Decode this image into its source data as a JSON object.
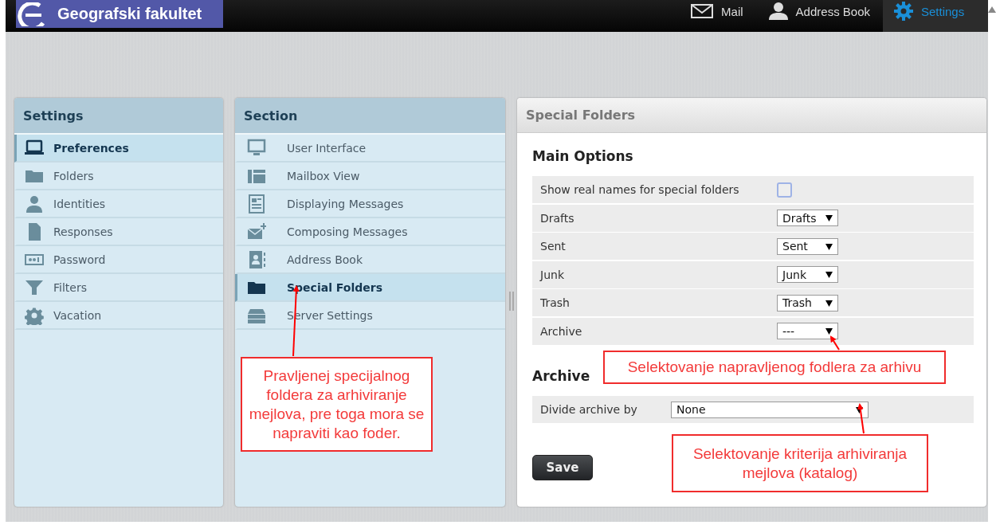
{
  "header": {
    "brand": "Geografski fakultet",
    "nav": [
      {
        "label": "Mail",
        "selected": false
      },
      {
        "label": "Address Book",
        "selected": false
      },
      {
        "label": "Settings",
        "selected": true
      }
    ]
  },
  "settings_panel": {
    "title": "Settings",
    "items": [
      {
        "label": "Preferences",
        "selected": true
      },
      {
        "label": "Folders",
        "selected": false
      },
      {
        "label": "Identities",
        "selected": false
      },
      {
        "label": "Responses",
        "selected": false
      },
      {
        "label": "Password",
        "selected": false
      },
      {
        "label": "Filters",
        "selected": false
      },
      {
        "label": "Vacation",
        "selected": false
      }
    ]
  },
  "section_panel": {
    "title": "Section",
    "items": [
      {
        "label": "User Interface",
        "selected": false
      },
      {
        "label": "Mailbox View",
        "selected": false
      },
      {
        "label": "Displaying Messages",
        "selected": false
      },
      {
        "label": "Composing Messages",
        "selected": false
      },
      {
        "label": "Address Book",
        "selected": false
      },
      {
        "label": "Special Folders",
        "selected": true
      },
      {
        "label": "Server Settings",
        "selected": false
      }
    ]
  },
  "content": {
    "title": "Special Folders",
    "main_options": {
      "heading": "Main Options",
      "rows": [
        {
          "kind": "checkbox",
          "label": "Show real names for special folders",
          "checked": false
        },
        {
          "kind": "select",
          "label": "Drafts",
          "value": "Drafts"
        },
        {
          "kind": "select",
          "label": "Sent",
          "value": "Sent"
        },
        {
          "kind": "select",
          "label": "Junk",
          "value": "Junk"
        },
        {
          "kind": "select",
          "label": "Trash",
          "value": "Trash"
        },
        {
          "kind": "select",
          "label": "Archive",
          "value": "---"
        }
      ]
    },
    "archive": {
      "heading": "Archive",
      "rows": [
        {
          "kind": "wideselect",
          "label": "Divide archive by",
          "value": "None"
        }
      ]
    },
    "save_button": "Save"
  },
  "annotations": [
    {
      "text": "Pravljenej specijalnog foldera za arhiviranje mejlova, pre toga mora se napraviti kao foder."
    },
    {
      "text": "Selektovanje napravljenog fodlera za arhivu"
    },
    {
      "text": "Selektovanje kriterija arhiviranja mejlova (katalog)"
    }
  ]
}
